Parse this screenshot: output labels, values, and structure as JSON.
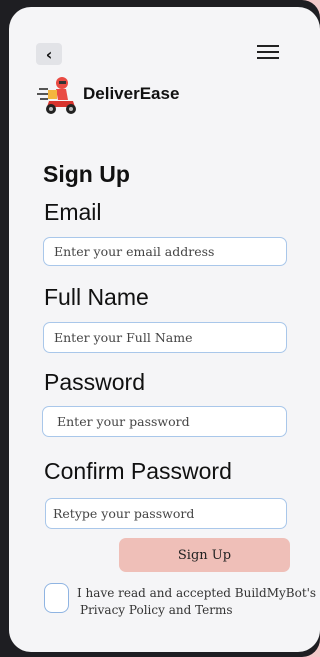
{
  "header": {
    "back_icon": "chevron-left-icon",
    "back_glyph": "‹",
    "menu_icon": "hamburger-menu-icon"
  },
  "brand": {
    "name": "DeliverEase",
    "logo_icon": "delivery-scooter-icon"
  },
  "form": {
    "title": "Sign Up",
    "email_label": "Email",
    "email_placeholder": "Enter your email address",
    "fullname_label": "Full Name",
    "fullname_placeholder": "Enter your Full Name",
    "password_label": "Password",
    "password_placeholder": "Enter your password",
    "confirm_label": "Confirm Password",
    "confirm_placeholder": "Retype your password",
    "submit_label": "Sign Up",
    "terms_line1": "I have read and accepted BuildMyBot's",
    "terms_line2": "Privacy Policy and Terms"
  },
  "colors": {
    "background": "#f2c9c9",
    "submit_button": "#efbfb8",
    "field_border": "#a9c7ea"
  }
}
